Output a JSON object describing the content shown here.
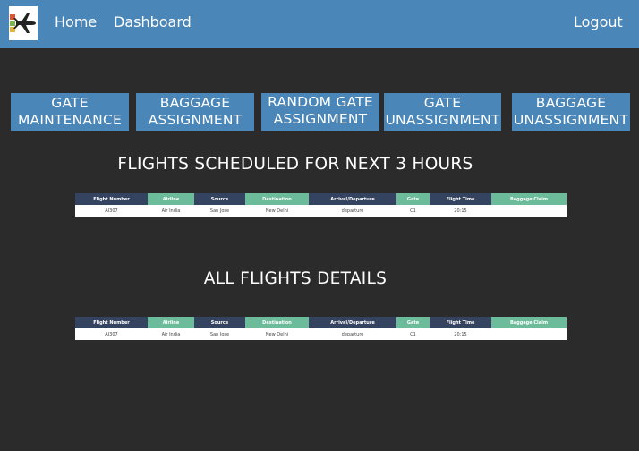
{
  "nav": {
    "home": "Home",
    "dashboard": "Dashboard",
    "logout": "Logout"
  },
  "actions": [
    {
      "label": "GATE MAINTENANCE"
    },
    {
      "label": "BAGGAGE ASSIGNMENT"
    },
    {
      "label": "RANDOM GATE ASSIGNMENT"
    },
    {
      "label": "GATE UNASSIGNMENT"
    },
    {
      "label": "BAGGAGE UNASSIGNMENT"
    }
  ],
  "upcoming": {
    "title": "FLIGHTS SCHEDULED FOR NEXT 3 HOURS",
    "columns": [
      "Flight Number",
      "Airline",
      "Source",
      "Destination",
      "Arrival/Departure",
      "Gate",
      "Flight Time",
      "Baggage Claim"
    ],
    "rows": [
      [
        "AI307",
        "Air India",
        "San Jose",
        "New Delhi",
        "departure",
        "C1",
        "20:15",
        ""
      ]
    ]
  },
  "all": {
    "title": "ALL FLIGHTS DETAILS",
    "columns": [
      "Flight Number",
      "Airline",
      "Source",
      "Destination",
      "Arrival/Departure",
      "Gate",
      "Flight Time",
      "Baggage Claim"
    ],
    "rows": [
      [
        "AI307",
        "Air India",
        "San Jose",
        "New Delhi",
        "departure",
        "C1",
        "20:15",
        ""
      ]
    ]
  },
  "colors": {
    "navbar": "#4a86b8",
    "background": "#2b2b2b",
    "header_dark": "#34435f",
    "header_teal": "#6cbb9b"
  },
  "icons": {
    "logo": "airplane-logo-icon"
  }
}
